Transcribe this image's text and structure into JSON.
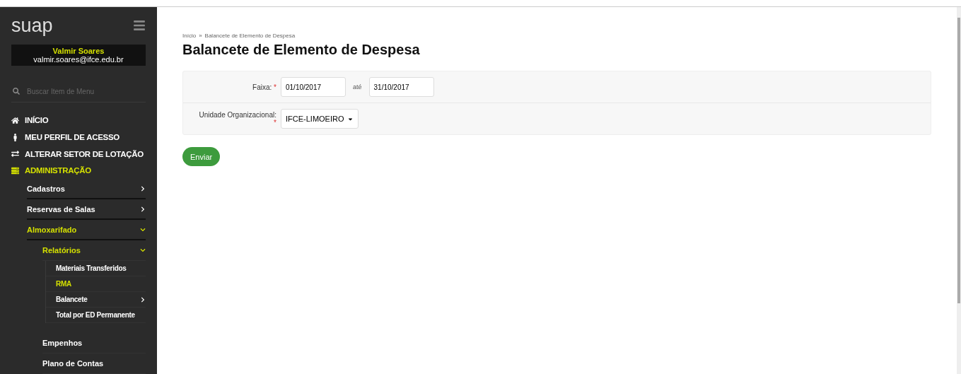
{
  "sidebar": {
    "logo": "suap",
    "user": {
      "name": "Valmir Soares",
      "email": "valmir.soares@ifce.edu.br"
    },
    "search": {
      "placeholder": "Buscar Item de Menu"
    },
    "items": [
      {
        "label": "INÍCIO",
        "active": false
      },
      {
        "label": "MEU PERFIL DE ACESSO",
        "active": false
      },
      {
        "label": "ALTERAR SETOR DE LOTAÇÃO",
        "active": false
      },
      {
        "label": "ADMINISTRAÇÃO",
        "active": true,
        "children": [
          {
            "label": "Cadastros",
            "active": false,
            "expanded": false
          },
          {
            "label": "Reservas de Salas",
            "active": false,
            "expanded": false
          },
          {
            "label": "Almoxarifado",
            "active": true,
            "expanded": true,
            "children": [
              {
                "label": "Relatórios",
                "active": true,
                "expanded": true,
                "children": [
                  {
                    "label": "Materiais Transferidos",
                    "active": false
                  },
                  {
                    "label": "RMA",
                    "active": true
                  },
                  {
                    "label": "Balancete",
                    "active": false,
                    "expanded": false
                  },
                  {
                    "label": "Total por ED Permanente",
                    "active": false
                  }
                ]
              },
              {
                "label": "Empenhos",
                "active": false
              },
              {
                "label": "Plano de Contas",
                "active": false
              }
            ]
          }
        ]
      }
    ]
  },
  "breadcrumb": {
    "items": [
      "Início",
      "Balancete de Elemento de Despesa"
    ],
    "separator": "»"
  },
  "title": "Balancete de Elemento de Despesa",
  "form": {
    "range": {
      "label": "Faixa:",
      "required_mark": "*",
      "from": "01/10/2017",
      "separator": "até",
      "to": "31/10/2017"
    },
    "unit": {
      "label": "Unidade Organizacional:",
      "required_mark": "*",
      "value": "IFCE-LIMOEIRO"
    },
    "submit": "Enviar"
  }
}
